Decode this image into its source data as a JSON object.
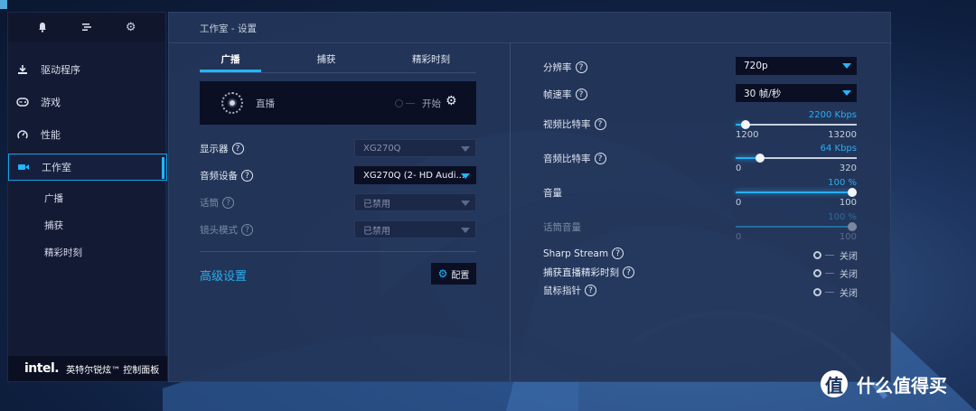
{
  "sidebar": {
    "top_icons": [
      "bell-icon",
      "list-icon",
      "gear-icon"
    ],
    "items": [
      {
        "label": "驱动程序",
        "icon": "download-icon"
      },
      {
        "label": "游戏",
        "icon": "gamepad-icon"
      },
      {
        "label": "性能",
        "icon": "gauge-icon"
      },
      {
        "label": "工作室",
        "icon": "camera-icon"
      }
    ],
    "sub_items": [
      "广播",
      "捕获",
      "精彩时刻"
    ],
    "footer_logo": "intel.",
    "footer_text": "英特尔锐炫™ 控制面板"
  },
  "main": {
    "title": "工作室 - 设置",
    "tabs": [
      "广播",
      "捕获",
      "精彩时刻"
    ],
    "preview": {
      "live_label": "直播",
      "start_label": "开始"
    },
    "fields": [
      {
        "label": "显示器",
        "value": "XG270Q",
        "enabled": false
      },
      {
        "label": "音频设备",
        "value": "XG270Q (2- HD Audi...",
        "enabled": true
      },
      {
        "label": "话筒",
        "value": "已禁用",
        "enabled": false
      },
      {
        "label": "镜头模式",
        "value": "已禁用",
        "enabled": false
      }
    ],
    "advanced_label": "高级设置",
    "config_button": "配置"
  },
  "right": {
    "resolution": {
      "label": "分辨率",
      "value": "720p"
    },
    "framerate": {
      "label": "帧速率",
      "value": "30 帧/秒"
    },
    "video_bitrate": {
      "label": "视频比特率",
      "value": "2200 Kbps",
      "min": "1200",
      "max": "13200",
      "level": 0.08
    },
    "audio_bitrate": {
      "label": "音频比特率",
      "value": "64 Kbps",
      "min": "0",
      "max": "320",
      "level": 0.2
    },
    "volume": {
      "label": "音量",
      "value": "100 %",
      "min": "0",
      "max": "100",
      "level": 1.0
    },
    "mic_volume": {
      "label": "话筒音量",
      "value": "100 %",
      "min": "0",
      "max": "100",
      "level": 1.0
    },
    "toggles": [
      {
        "label": "Sharp Stream",
        "state": "关闭"
      },
      {
        "label": "捕获直播精彩时刻",
        "state": "关闭"
      },
      {
        "label": "鼠标指针",
        "state": "关闭"
      }
    ]
  },
  "watermark": {
    "symbol": "值",
    "text": "什么值得买"
  },
  "colors": {
    "accent": "#22b6ff",
    "panel": "#243659",
    "sidebar": "#131a33"
  }
}
